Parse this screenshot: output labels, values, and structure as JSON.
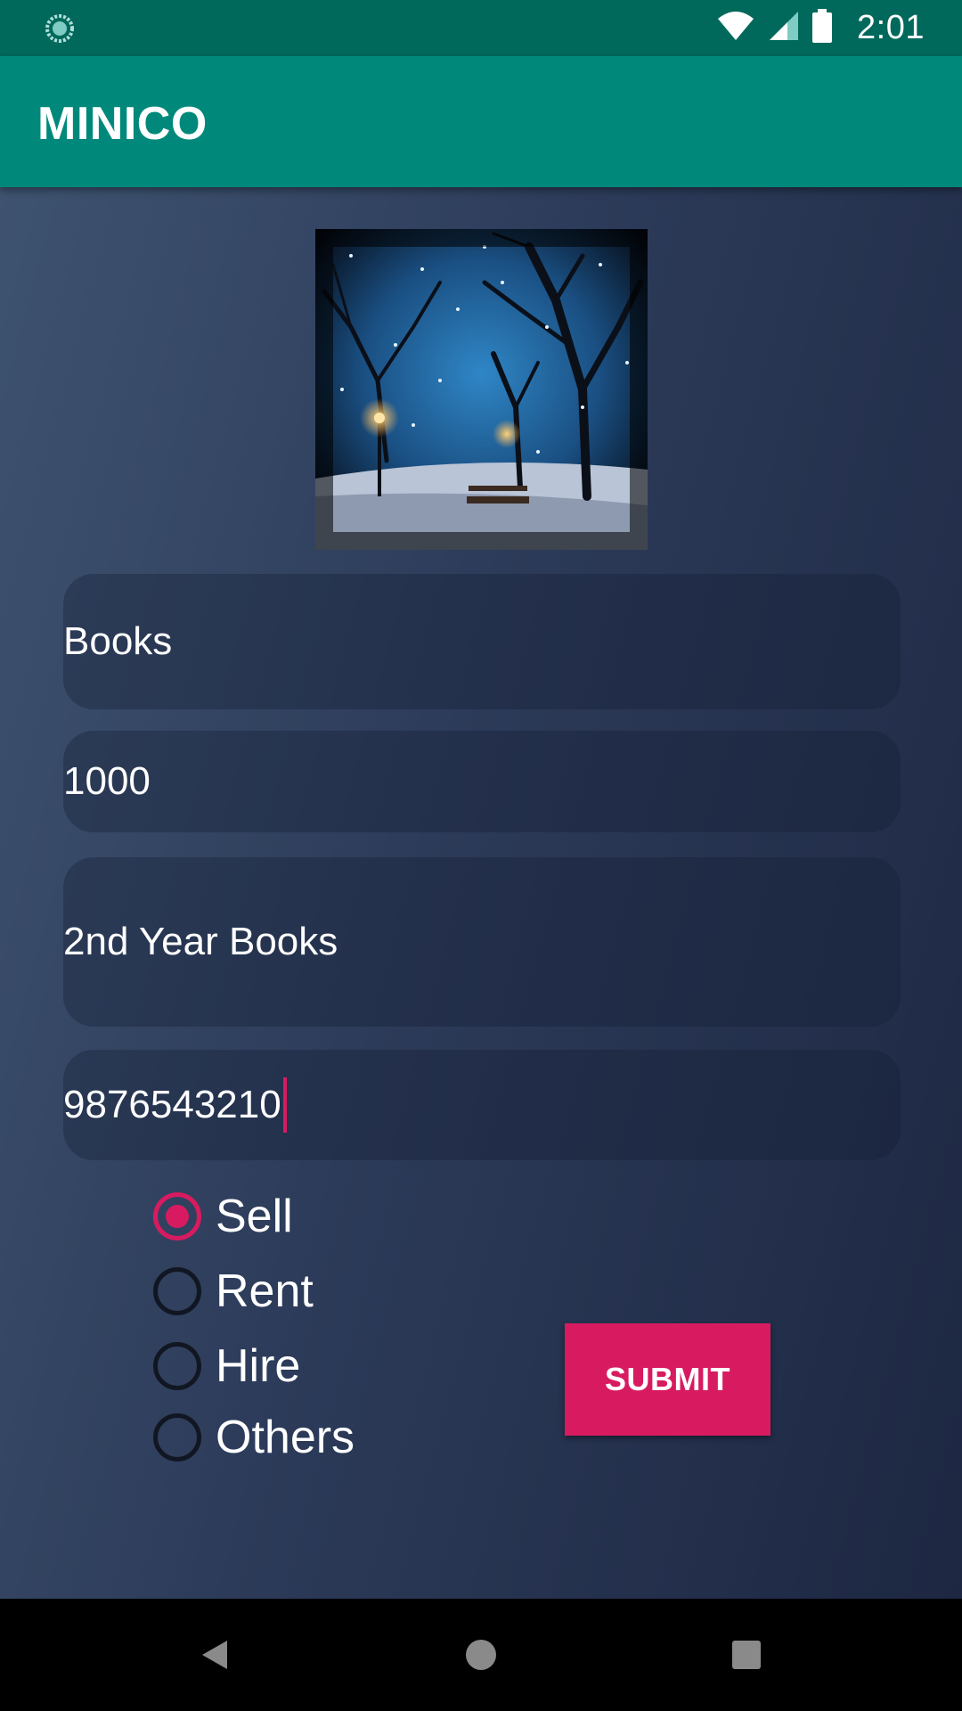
{
  "status_bar": {
    "time": "2:01",
    "left_icon": "sync-icon",
    "icons": [
      "wifi-icon",
      "cell-signal-icon",
      "battery-icon"
    ]
  },
  "app_bar": {
    "title": "MINICO"
  },
  "image": {
    "icon": "winter-park-photo"
  },
  "form": {
    "category": "Books",
    "price": "1000",
    "description": "2nd Year Books",
    "phone": "9876543210"
  },
  "options": {
    "selected": "Sell",
    "items": [
      "Sell",
      "Rent",
      "Hire",
      "Others"
    ]
  },
  "submit_label": "SUBMIT",
  "nav": {
    "icons": [
      "back-icon",
      "home-icon",
      "recents-icon"
    ]
  },
  "colors": {
    "status_bar": "#00695c",
    "app_bar": "#00897b",
    "accent": "#d81b60"
  }
}
